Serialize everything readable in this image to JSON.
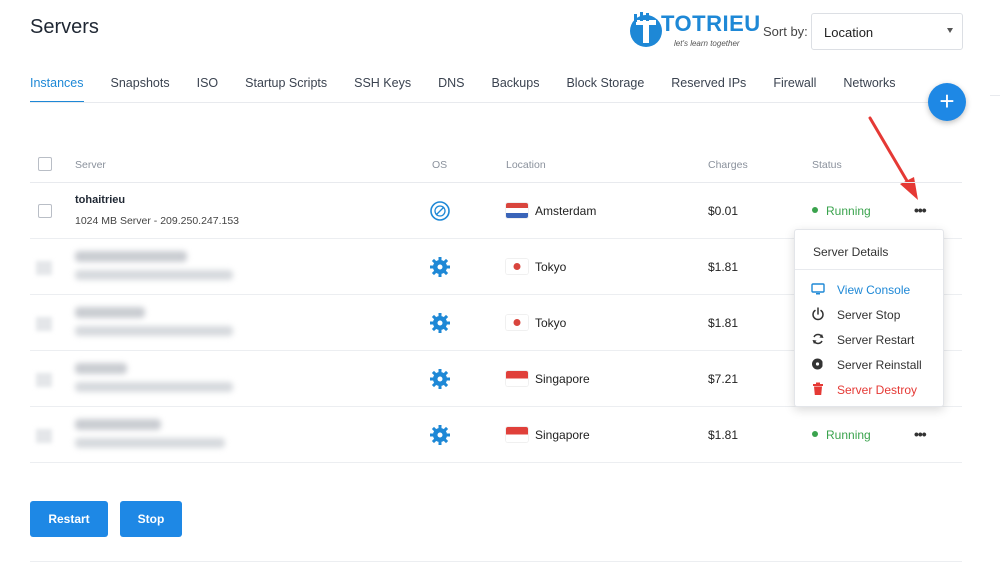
{
  "page": {
    "title": "Servers"
  },
  "logo": {
    "text": "TOTRIEU",
    "tagline": "let's learn together"
  },
  "sort": {
    "label": "Sort by:",
    "value": "Location"
  },
  "tabs": [
    {
      "label": "Instances",
      "active": true
    },
    {
      "label": "Snapshots"
    },
    {
      "label": "ISO"
    },
    {
      "label": "Startup Scripts"
    },
    {
      "label": "SSH Keys"
    },
    {
      "label": "DNS"
    },
    {
      "label": "Backups"
    },
    {
      "label": "Block Storage"
    },
    {
      "label": "Reserved IPs"
    },
    {
      "label": "Firewall"
    },
    {
      "label": "Networks"
    }
  ],
  "fab": {
    "label": "+"
  },
  "table": {
    "headers": {
      "server": "Server",
      "os": "OS",
      "location": "Location",
      "charges": "Charges",
      "status": "Status"
    },
    "rows": [
      {
        "name": "tohaitrieu",
        "subtitle": "1024 MB Server - 209.250.247.153",
        "os_icon": "disc-icon",
        "location": "Amsterdam",
        "flag": "netherlands",
        "charges": "$0.01",
        "status": "Running",
        "more": "•••"
      },
      {
        "name": "",
        "subtitle": "",
        "os_icon": "gear-icon",
        "location": "Tokyo",
        "flag": "japan",
        "charges": "$1.81",
        "status": "",
        "more": ""
      },
      {
        "name": "",
        "subtitle": "",
        "os_icon": "gear-icon",
        "location": "Tokyo",
        "flag": "japan",
        "charges": "$1.81",
        "status": "",
        "more": ""
      },
      {
        "name": "",
        "subtitle": "",
        "os_icon": "gear-icon",
        "location": "Singapore",
        "flag": "singapore",
        "charges": "$7.21",
        "status": "",
        "more": ""
      },
      {
        "name": "",
        "subtitle": "",
        "os_icon": "gear-icon",
        "location": "Singapore",
        "flag": "singapore",
        "charges": "$1.81",
        "status": "Running",
        "more": "•••"
      }
    ]
  },
  "dropdown": {
    "header": "Server Details",
    "items": [
      {
        "label": "View Console",
        "icon": "monitor-icon",
        "color": "#1e88d6"
      },
      {
        "label": "Server Stop",
        "icon": "power-icon"
      },
      {
        "label": "Server Restart",
        "icon": "refresh-icon"
      },
      {
        "label": "Server Reinstall",
        "icon": "disc-icon"
      },
      {
        "label": "Server Destroy",
        "icon": "trash-icon",
        "color": "#e53935"
      }
    ]
  },
  "actions": {
    "restart_label": "Restart",
    "stop_label": "Stop"
  },
  "colors": {
    "accent": "#1e88e5",
    "running": "#3aa34d",
    "danger": "#e53935",
    "annotation_arrow": "#e53935"
  }
}
